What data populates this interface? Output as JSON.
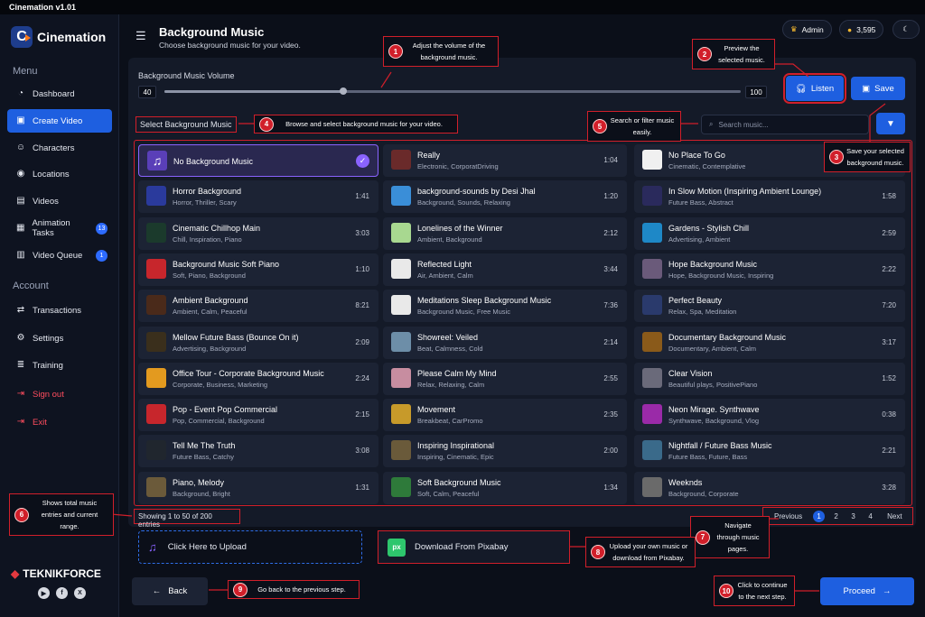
{
  "window": {
    "title": "Cinemation v1.01"
  },
  "sidebar": {
    "brand": "Cinemation",
    "menu_title": "Menu",
    "account_title": "Account",
    "items": [
      {
        "label": "Dashboard",
        "icon": "dashboard-icon"
      },
      {
        "label": "Create Video",
        "icon": "video-plus-icon",
        "active": true
      },
      {
        "label": "Characters",
        "icon": "characters-icon"
      },
      {
        "label": "Locations",
        "icon": "location-pin-icon"
      },
      {
        "label": "Videos",
        "icon": "calendar-icon"
      },
      {
        "label": "Animation Tasks",
        "icon": "tasks-icon",
        "badge": "13"
      },
      {
        "label": "Video Queue",
        "icon": "queue-icon",
        "badge": "1"
      }
    ],
    "account_items": [
      {
        "label": "Transactions",
        "icon": "transactions-icon"
      },
      {
        "label": "Settings",
        "icon": "gear-icon"
      },
      {
        "label": "Training",
        "icon": "book-icon"
      },
      {
        "label": "Sign out",
        "icon": "sign-out-icon"
      },
      {
        "label": "Exit",
        "icon": "exit-icon"
      }
    ],
    "footer_brand": "TEKNIKFORCE"
  },
  "header": {
    "title": "Background Music",
    "subtitle": "Choose background music for your video.",
    "user": "Admin",
    "credits": "3,595"
  },
  "volume": {
    "label": "Background Music Volume",
    "min": "40",
    "max": "100",
    "level_fraction": 0.31
  },
  "buttons": {
    "listen": "Listen",
    "save": "Save",
    "upload": "Click Here to Upload",
    "pixabay": "Download From Pixabay",
    "back": "Back",
    "proceed": "Proceed"
  },
  "select_label": "Select Background Music",
  "search": {
    "placeholder": "Search music..."
  },
  "tracks": [
    [
      {
        "name": "No Background Music",
        "tags": "",
        "duration": "",
        "selected": true
      },
      {
        "name": "Horror Background",
        "tags": "Horror, Thriller, Scary",
        "duration": "1:41"
      },
      {
        "name": "Cinematic Chillhop Main",
        "tags": "Chill, Inspiration, Piano",
        "duration": "3:03"
      },
      {
        "name": "Background Music Soft Piano",
        "tags": "Soft, Piano, Background",
        "duration": "1:10"
      },
      {
        "name": "Ambient Background",
        "tags": "Ambient, Calm, Peaceful",
        "duration": "8:21"
      },
      {
        "name": "Mellow Future Bass (Bounce On it)",
        "tags": "Advertising, Background",
        "duration": "2:09"
      },
      {
        "name": "Office Tour - Corporate Background Music",
        "tags": "Corporate, Business, Marketing",
        "duration": "2:24"
      },
      {
        "name": "Pop - Event Pop Commercial",
        "tags": "Pop, Commercial, Background",
        "duration": "2:15"
      },
      {
        "name": "Tell Me The Truth",
        "tags": "Future Bass, Catchy",
        "duration": "3:08"
      },
      {
        "name": "Piano, Melody",
        "tags": "Background, Bright",
        "duration": "1:31"
      }
    ],
    [
      {
        "name": "Really",
        "tags": "Electronic, CorporatDriving",
        "duration": "1:04"
      },
      {
        "name": "background-sounds by Desi Jhal",
        "tags": "Background, Sounds, Relaxing",
        "duration": "1:20"
      },
      {
        "name": "Lonelines of the Winner",
        "tags": "Ambient, Background",
        "duration": "2:12"
      },
      {
        "name": "Reflected Light",
        "tags": "Air, Ambient, Calm",
        "duration": "3:44"
      },
      {
        "name": "Meditations Sleep Background Music",
        "tags": "Background Music, Free Music",
        "duration": "7:36"
      },
      {
        "name": "Showreel: Veiled",
        "tags": "Beat, Calmness, Cold",
        "duration": "2:14"
      },
      {
        "name": "Please Calm My Mind",
        "tags": "Relax, Relaxing, Calm",
        "duration": "2:55"
      },
      {
        "name": "Movement",
        "tags": "Breakbeat, CarPromo",
        "duration": "2:35"
      },
      {
        "name": "Inspiring Inspirational",
        "tags": "Inspiring, Cinematic, Epic",
        "duration": "2:00"
      },
      {
        "name": "Soft Background Music",
        "tags": "Soft, Calm, Peaceful",
        "duration": "1:34"
      }
    ],
    [
      {
        "name": "No Place To Go",
        "tags": "Cinematic, Contemplative",
        "duration": ""
      },
      {
        "name": "In Slow Motion (Inspiring Ambient Lounge)",
        "tags": "Future Bass, Abstract",
        "duration": "1:58"
      },
      {
        "name": "Gardens - Stylish Chill",
        "tags": "Advertising, Ambient",
        "duration": "2:59"
      },
      {
        "name": "Hope Background Music",
        "tags": "Hope, Background Music, Inspiring",
        "duration": "2:22"
      },
      {
        "name": "Perfect Beauty",
        "tags": "Relax, Spa, Meditation",
        "duration": "7:20"
      },
      {
        "name": "Documentary Background Music",
        "tags": "Documentary, Ambient, Calm",
        "duration": "3:17"
      },
      {
        "name": "Clear Vision",
        "tags": "Beautiful plays, PositivePiano",
        "duration": "1:52"
      },
      {
        "name": "Neon Mirage. Synthwave",
        "tags": "Synthwave, Background, Vlog",
        "duration": "0:38"
      },
      {
        "name": "Nightfall / Future Bass Music",
        "tags": "Future Bass, Future, Bass",
        "duration": "2:21"
      },
      {
        "name": "Weeknds",
        "tags": "Background, Corporate",
        "duration": "3:28"
      }
    ]
  ],
  "thumb_colors": [
    [
      "#5a3fb8",
      "#2a3a9c",
      "#1b3a2c",
      "#c7262c",
      "#4a2a1a",
      "#3a2f1c",
      "#e39a1f",
      "#c7262c",
      "#20262e",
      "#6b5a3a"
    ],
    [
      "#6a2a2a",
      "#3a8ed8",
      "#a8d890",
      "#e9e9e9",
      "#e9e9e9",
      "#6d8ea8",
      "#c78da0",
      "#c79a2a",
      "#6a5a3a",
      "#2e7a3a"
    ],
    [
      "#f0f0f0",
      "#2a2a5c",
      "#1e88c7",
      "#6a5a7a",
      "#2a3a6c",
      "#8a5a1a",
      "#6a6a7a",
      "#9a2aa8",
      "#3a6a8a",
      "#6a6a6a"
    ]
  ],
  "footer": {
    "showing": "Showing 1 to 50 of 200 entries"
  },
  "pagination": {
    "previous": "Previous",
    "pages": [
      "1",
      "2",
      "3",
      "4"
    ],
    "current": "1",
    "next": "Next"
  },
  "callouts": [
    {
      "num": "1",
      "text": "Adjust the volume of the background music."
    },
    {
      "num": "2",
      "text": "Preview the selected music."
    },
    {
      "num": "3",
      "text": "Save your selected background music."
    },
    {
      "num": "4",
      "text": "Browse and select background music for your video."
    },
    {
      "num": "5",
      "text": "Search or filter music easily."
    },
    {
      "num": "6",
      "text": "Shows total music entries and current range."
    },
    {
      "num": "7",
      "text": "Navigate through music pages."
    },
    {
      "num": "8",
      "text": "Upload your own music or download from Pixabay."
    },
    {
      "num": "9",
      "text": "Go back to the previous step."
    },
    {
      "num": "10",
      "text": "Click to continue to the next step."
    }
  ],
  "colors": {
    "accent": "#1e5fe0",
    "callout": "#d11f2a",
    "selected": "#8a63ff",
    "background": "#0b0f19"
  }
}
